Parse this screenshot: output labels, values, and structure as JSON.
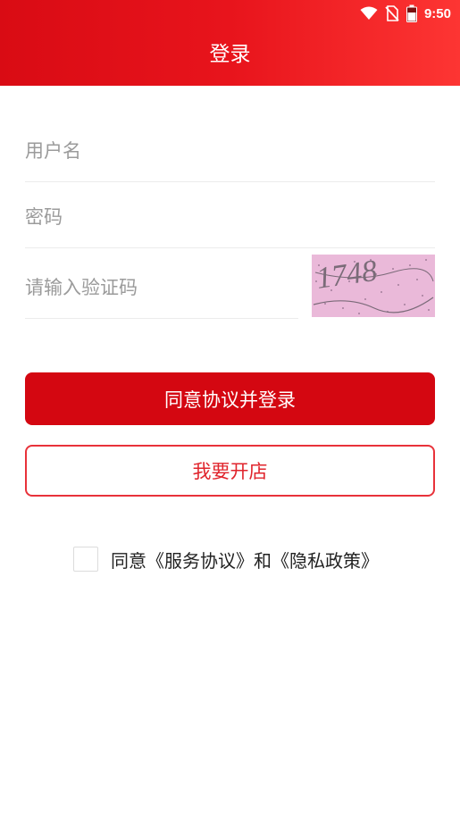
{
  "status_bar": {
    "time": "9:50",
    "icons": [
      "wifi-icon",
      "no-sim-icon",
      "battery-icon"
    ]
  },
  "header": {
    "title": "登录"
  },
  "form": {
    "username_placeholder": "用户名",
    "password_placeholder": "密码",
    "captcha_placeholder": "请输入验证码",
    "captcha_image_text": "1748"
  },
  "actions": {
    "login_label": "同意协议并登录",
    "open_store_label": "我要开店"
  },
  "agreement": {
    "text": "同意《服务协议》和《隐私政策》",
    "checked": false
  },
  "colors": {
    "brand_red": "#d40711",
    "header_gradient_end": "#fd3533",
    "outline_red": "#e8323a",
    "captcha_bg": "#e9b8d8"
  }
}
